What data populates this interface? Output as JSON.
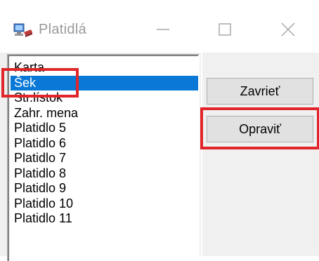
{
  "window": {
    "title": "Platidlá",
    "app_icon": "computer-network-icon",
    "minimize_icon": "minimize-icon",
    "maximize_icon": "maximize-icon",
    "close_icon": "close-icon"
  },
  "list": {
    "items": [
      {
        "label": "Karta"
      },
      {
        "label": "Šek",
        "selected": true
      },
      {
        "label": "Str.lístok"
      },
      {
        "label": "Zahr. mena"
      },
      {
        "label": "Platidlo 5"
      },
      {
        "label": "Platidlo 6"
      },
      {
        "label": "Platidlo 7"
      },
      {
        "label": "Platidlo 8"
      },
      {
        "label": "Platidlo 9"
      },
      {
        "label": "Platidlo 10"
      },
      {
        "label": "Platidlo 11"
      }
    ]
  },
  "buttons": {
    "close_label": "Zavrieť",
    "edit_label": "Opraviť"
  },
  "colors": {
    "selection": "#0a78d7",
    "annotation_red": "#e0262b"
  }
}
